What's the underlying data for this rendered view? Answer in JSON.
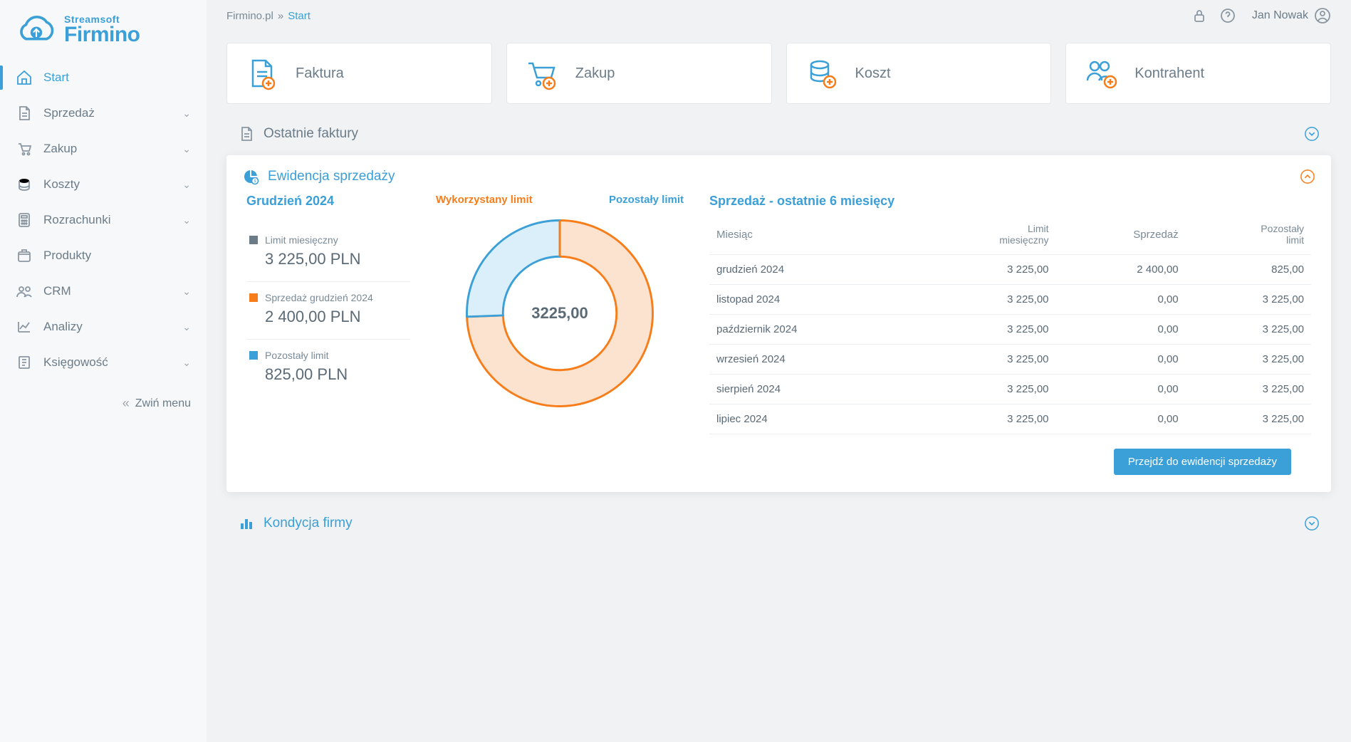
{
  "brand": {
    "top": "Streamsoft",
    "bottom": "Firmino"
  },
  "breadcrumb": {
    "root": "Firmino.pl",
    "sep": "»",
    "current": "Start"
  },
  "user": {
    "name": "Jan Nowak"
  },
  "sidebar": {
    "collapse_label": "Zwiń menu",
    "items": [
      {
        "label": "Start",
        "expandable": false,
        "active": true
      },
      {
        "label": "Sprzedaż",
        "expandable": true,
        "active": false
      },
      {
        "label": "Zakup",
        "expandable": true,
        "active": false
      },
      {
        "label": "Koszty",
        "expandable": true,
        "active": false
      },
      {
        "label": "Rozrachunki",
        "expandable": true,
        "active": false
      },
      {
        "label": "Produkty",
        "expandable": false,
        "active": false
      },
      {
        "label": "CRM",
        "expandable": true,
        "active": false
      },
      {
        "label": "Analizy",
        "expandable": true,
        "active": false
      },
      {
        "label": "Księgowość",
        "expandable": true,
        "active": false
      }
    ]
  },
  "quick": [
    {
      "label": "Faktura",
      "icon": "document-add-icon"
    },
    {
      "label": "Zakup",
      "icon": "cart-add-icon"
    },
    {
      "label": "Koszt",
      "icon": "coins-add-icon"
    },
    {
      "label": "Kontrahent",
      "icon": "people-add-icon"
    }
  ],
  "sections": {
    "recent_invoices": {
      "title": "Ostatnie faktury"
    },
    "sales_register": {
      "title": "Ewidencja sprzedaży"
    },
    "company_health": {
      "title": "Kondycja firmy"
    }
  },
  "sales": {
    "month_title": "Grudzień 2024",
    "stats": {
      "limit_label": "Limit miesięczny",
      "limit_value": "3 225,00 PLN",
      "sold_label": "Sprzedaż grudzień 2024",
      "sold_value": "2 400,00 PLN",
      "remain_label": "Pozostały limit",
      "remain_value": "825,00 PLN"
    },
    "chart_used_label": "Wykorzystany limit",
    "chart_remain_label": "Pozostały limit",
    "chart_center": "3225,00",
    "table_title": "Sprzedaż - ostatnie 6 miesięcy",
    "columns": {
      "month": "Miesiąc",
      "limit_l1": "Limit",
      "limit_l2": "miesięczny",
      "sales": "Sprzedaż",
      "remain_l1": "Pozostały",
      "remain_l2": "limit"
    },
    "rows": [
      {
        "month": "grudzień 2024",
        "limit": "3 225,00",
        "sales": "2 400,00",
        "remain": "825,00"
      },
      {
        "month": "listopad 2024",
        "limit": "3 225,00",
        "sales": "0,00",
        "remain": "3 225,00"
      },
      {
        "month": "październik 2024",
        "limit": "3 225,00",
        "sales": "0,00",
        "remain": "3 225,00"
      },
      {
        "month": "wrzesień 2024",
        "limit": "3 225,00",
        "sales": "0,00",
        "remain": "3 225,00"
      },
      {
        "month": "sierpień 2024",
        "limit": "3 225,00",
        "sales": "0,00",
        "remain": "3 225,00"
      },
      {
        "month": "lipiec 2024",
        "limit": "3 225,00",
        "sales": "0,00",
        "remain": "3 225,00"
      }
    ],
    "cta": "Przejdź do ewidencji sprzedaży"
  },
  "chart_data": {
    "type": "pie",
    "title": "Ewidencja sprzedaży — Grudzień 2024",
    "total_label": "3225,00",
    "series": [
      {
        "name": "Wykorzystany limit",
        "value": 2400.0,
        "color": "#fbe3cf",
        "stroke": "#f77d1a"
      },
      {
        "name": "Pozostały limit",
        "value": 825.0,
        "color": "#dbeffa",
        "stroke": "#3b9fd8"
      }
    ],
    "total": 3225.0
  },
  "colors": {
    "primary": "#3b9fd8",
    "accent": "#f77d1a",
    "muted": "#6b7c88"
  }
}
